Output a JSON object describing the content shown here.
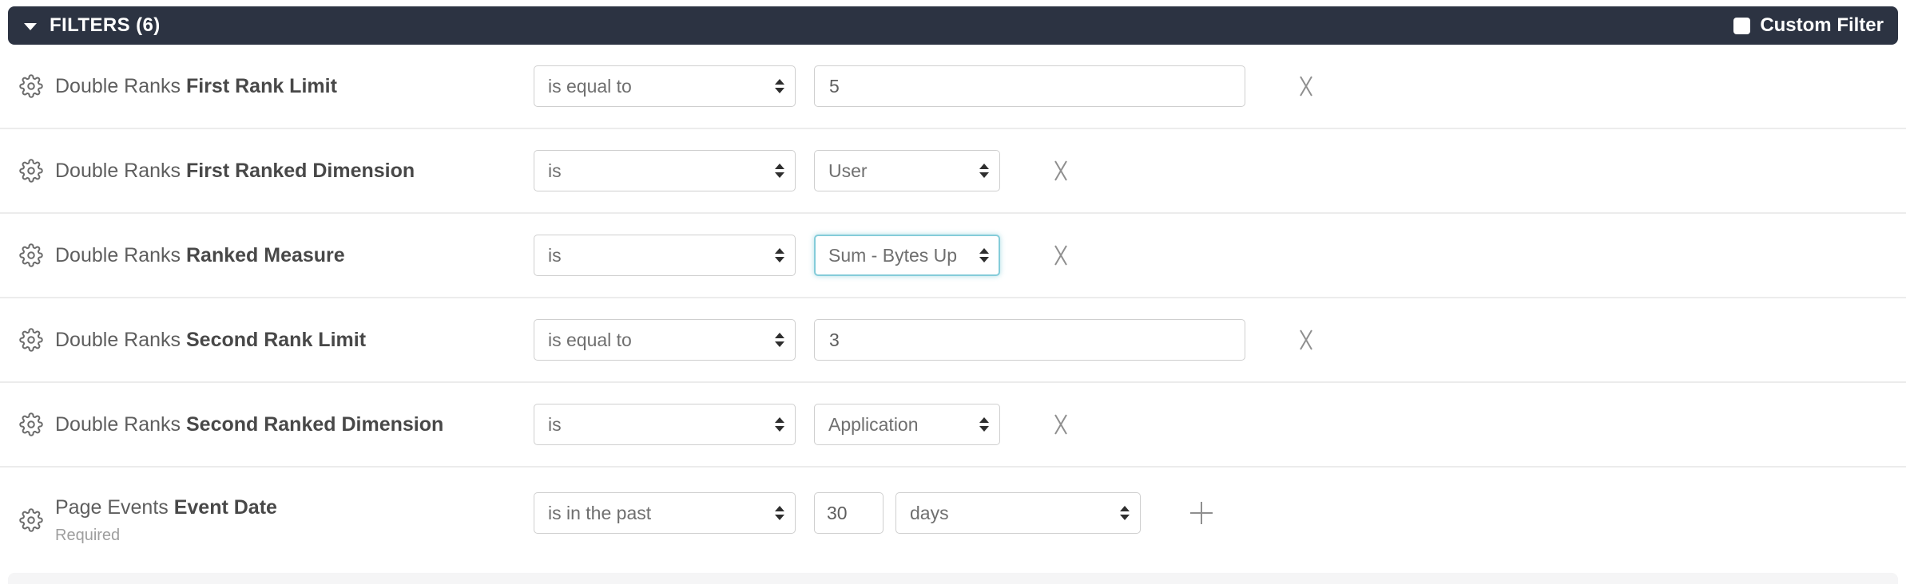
{
  "header": {
    "title": "FILTERS (6)",
    "custom_filter": {
      "label": "Custom Filter",
      "checked": false
    }
  },
  "colors": {
    "bar_bg": "#2c3342",
    "focus_accent": "#84ccd9",
    "divider": "#ececec",
    "control_border": "#cfcfcf",
    "label_text": "#5e5e5e",
    "label_bold_text": "#484848",
    "muted_text": "#9e9e9e"
  },
  "icons": {
    "gear": "gear-icon",
    "caret": "caret-down-icon",
    "remove": "x-icon",
    "add": "plus-icon",
    "select_arrows": "up-down-arrows-icon"
  },
  "rows": [
    {
      "group": "Double Ranks",
      "field": "First Rank Limit",
      "operator": "is equal to",
      "value": "5",
      "action": "remove"
    },
    {
      "group": "Double Ranks",
      "field": "First Ranked Dimension",
      "operator": "is",
      "value": "User",
      "action": "remove"
    },
    {
      "group": "Double Ranks",
      "field": "Ranked Measure",
      "operator": "is",
      "value": "Sum - Bytes Up",
      "action": "remove",
      "focused": true
    },
    {
      "group": "Double Ranks",
      "field": "Second Rank Limit",
      "operator": "is equal to",
      "value": "3",
      "action": "remove"
    },
    {
      "group": "Double Ranks",
      "field": "Second Ranked Dimension",
      "operator": "is",
      "value": "Application",
      "action": "remove"
    },
    {
      "group": "Page Events",
      "field": "Event Date",
      "required_note": "Required",
      "operator": "is in the past",
      "value": "30",
      "unit": "days",
      "action": "add"
    }
  ]
}
